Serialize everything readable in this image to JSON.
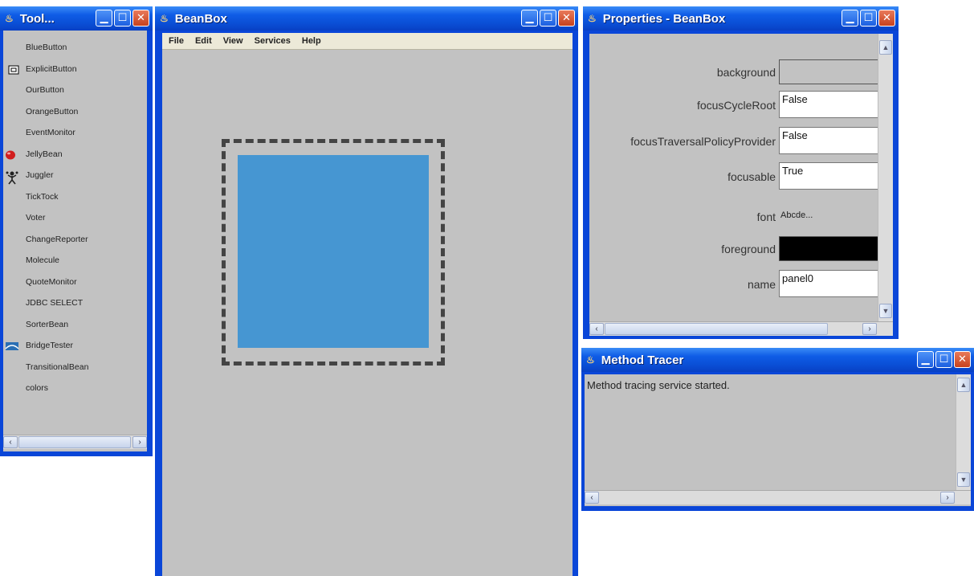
{
  "toolbox": {
    "title": "Tool...",
    "items": [
      {
        "label": "BlueButton",
        "icon": ""
      },
      {
        "label": "ExplicitButton",
        "icon": "button-icon"
      },
      {
        "label": "OurButton",
        "icon": ""
      },
      {
        "label": "OrangeButton",
        "icon": ""
      },
      {
        "label": "EventMonitor",
        "icon": ""
      },
      {
        "label": "JellyBean",
        "icon": "jellybean-icon"
      },
      {
        "label": "Juggler",
        "icon": "juggler-icon"
      },
      {
        "label": "TickTock",
        "icon": ""
      },
      {
        "label": "Voter",
        "icon": ""
      },
      {
        "label": "ChangeReporter",
        "icon": ""
      },
      {
        "label": "Molecule",
        "icon": ""
      },
      {
        "label": "QuoteMonitor",
        "icon": ""
      },
      {
        "label": "JDBC SELECT",
        "icon": ""
      },
      {
        "label": "SorterBean",
        "icon": ""
      },
      {
        "label": "BridgeTester",
        "icon": "bridge-icon"
      },
      {
        "label": "TransitionalBean",
        "icon": ""
      },
      {
        "label": "colors",
        "icon": ""
      }
    ]
  },
  "beanbox": {
    "title": "BeanBox",
    "menu": [
      "File",
      "Edit",
      "View",
      "Services",
      "Help"
    ],
    "panel_color": "#4696d2"
  },
  "properties": {
    "title": "Properties - BeanBox",
    "rows": [
      {
        "label": "background",
        "value": "",
        "kind": "color",
        "color": "#c2c2c2"
      },
      {
        "label": "focusCycleRoot",
        "value": "False",
        "kind": "text"
      },
      {
        "label": "focusTraversalPolicyProvider",
        "value": "False",
        "kind": "text"
      },
      {
        "label": "focusable",
        "value": "True",
        "kind": "text"
      },
      {
        "label": "font",
        "value": "Abcde...",
        "kind": "plain"
      },
      {
        "label": "foreground",
        "value": "",
        "kind": "color",
        "color": "#000000"
      },
      {
        "label": "name",
        "value": "panel0",
        "kind": "text"
      }
    ]
  },
  "tracer": {
    "title": "Method Tracer",
    "text": "Method tracing service started."
  },
  "colors": {
    "titlebar": "#0a4fd6",
    "client": "#c2c2c2",
    "close": "#c7411d"
  }
}
